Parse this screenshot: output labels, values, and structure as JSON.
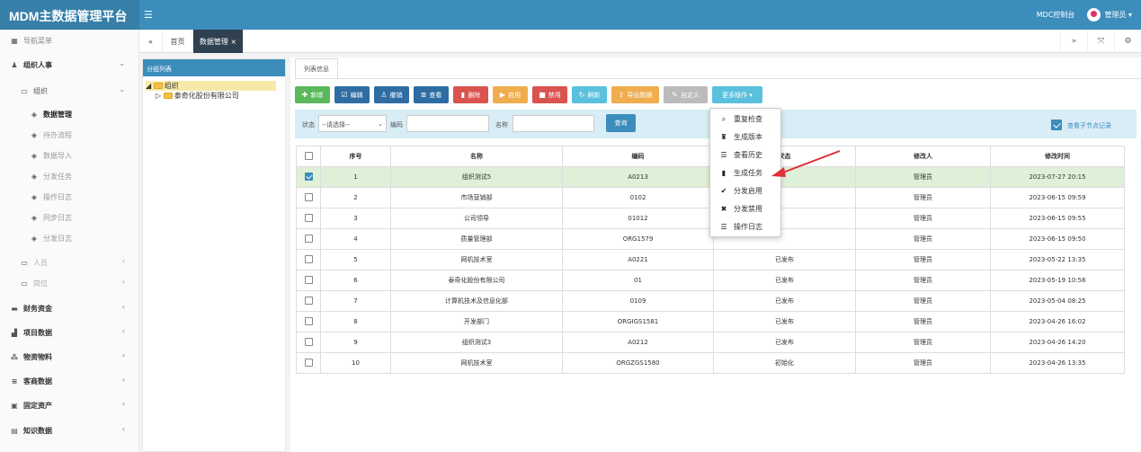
{
  "header": {
    "app_title": "MDM主数据管理平台",
    "toggle_icon": "bars-icon",
    "console_label": "MDC控制台",
    "user_label": "管理员"
  },
  "sidebar": {
    "nav_title": "导航菜单",
    "items": [
      {
        "label": "组织人事",
        "icon": "users-icon"
      },
      {
        "label": "组织",
        "icon": "folder-icon"
      },
      {
        "label": "数据管理",
        "icon": "tag-icon"
      },
      {
        "label": "待办流程",
        "icon": "tag-icon"
      },
      {
        "label": "数据导入",
        "icon": "tag-icon"
      },
      {
        "label": "分发任务",
        "icon": "tag-icon"
      },
      {
        "label": "操作日志",
        "icon": "tag-icon"
      },
      {
        "label": "同步日志",
        "icon": "tag-icon"
      },
      {
        "label": "分发日志",
        "icon": "tag-icon"
      },
      {
        "label": "人员",
        "icon": "folder-icon"
      },
      {
        "label": "岗位",
        "icon": "folder-icon"
      },
      {
        "label": "财务资金",
        "icon": "card-icon"
      },
      {
        "label": "项目数据",
        "icon": "chart-icon"
      },
      {
        "label": "物资物料",
        "icon": "cubes-icon"
      },
      {
        "label": "客商数据",
        "icon": "list-icon"
      },
      {
        "label": "固定资产",
        "icon": "box-icon"
      },
      {
        "label": "知识数据",
        "icon": "book-icon"
      }
    ]
  },
  "tabs": {
    "home": "首页",
    "current": "数据管理"
  },
  "tree": {
    "title": "分组列表",
    "root": "组织",
    "child": "泰奇化股份有限公司"
  },
  "panel": {
    "tab_label": "列表信息"
  },
  "toolbar": {
    "new": "新增",
    "edit": "编辑",
    "delete_mark": "撤销",
    "view": "查看",
    "remove": "删除",
    "enable": "启用",
    "disable": "禁用",
    "refresh": "刷新",
    "export": "导出数据",
    "customize": "自定义",
    "more": "更多操作"
  },
  "search": {
    "status_label": "状态",
    "status_value": "--请选择--",
    "code_label": "编码",
    "name_label": "名称",
    "query_button": "查询",
    "sub_records_label": "查看子节点记录"
  },
  "table": {
    "headers": [
      "序号",
      "名称",
      "编码",
      "状态",
      "修改人",
      "修改时间"
    ],
    "rows": [
      {
        "no": "1",
        "name": "组织测试5",
        "code": "A0213",
        "status": "",
        "modifier": "管理员",
        "time": "2023-07-27 20:15",
        "checked": true
      },
      {
        "no": "2",
        "name": "市场营销部",
        "code": "0102",
        "status": "",
        "modifier": "管理员",
        "time": "2023-06-15 09:59",
        "checked": false
      },
      {
        "no": "3",
        "name": "公司领导",
        "code": "01012",
        "status": "",
        "modifier": "管理员",
        "time": "2023-06-15 09:55",
        "checked": false
      },
      {
        "no": "4",
        "name": "质量管理部",
        "code": "ORG1579",
        "status": "",
        "modifier": "管理员",
        "time": "2023-06-15 09:50",
        "checked": false
      },
      {
        "no": "5",
        "name": "网机技术室",
        "code": "A0221",
        "status": "已发布",
        "modifier": "管理员",
        "time": "2023-05-22 13:35",
        "checked": false
      },
      {
        "no": "6",
        "name": "泰奇化股份有限公司",
        "code": "01",
        "status": "已发布",
        "modifier": "管理员",
        "time": "2023-05-19 10:56",
        "checked": false
      },
      {
        "no": "7",
        "name": "计算机技术及信息化部",
        "code": "0109",
        "status": "已发布",
        "modifier": "管理员",
        "time": "2023-05-04 08:25",
        "checked": false
      },
      {
        "no": "8",
        "name": "开发部门",
        "code": "ORGIGS1581",
        "status": "已发布",
        "modifier": "管理员",
        "time": "2023-04-26 16:02",
        "checked": false
      },
      {
        "no": "9",
        "name": "组织测试3",
        "code": "A0212",
        "status": "已发布",
        "modifier": "管理员",
        "time": "2023-04-26 14:20",
        "checked": false
      },
      {
        "no": "10",
        "name": "网机技术室",
        "code": "ORGZGS1580",
        "status": "初始化",
        "modifier": "管理员",
        "time": "2023-04-26 13:35",
        "checked": false
      }
    ]
  },
  "dropdown": {
    "items": [
      {
        "label": "重复检查",
        "icon": "search-icon"
      },
      {
        "label": "生成版本",
        "icon": "stamp-icon"
      },
      {
        "label": "查看历史",
        "icon": "list-icon"
      },
      {
        "label": "生成任务",
        "icon": "file-icon"
      },
      {
        "label": "分发启用",
        "icon": "check-icon"
      },
      {
        "label": "分发禁用",
        "icon": "close-icon"
      },
      {
        "label": "操作日志",
        "icon": "list-icon"
      }
    ]
  },
  "colors": {
    "header": "#3c8dbc",
    "selected_row": "#dff0d8",
    "arrow": "#e0303a"
  }
}
